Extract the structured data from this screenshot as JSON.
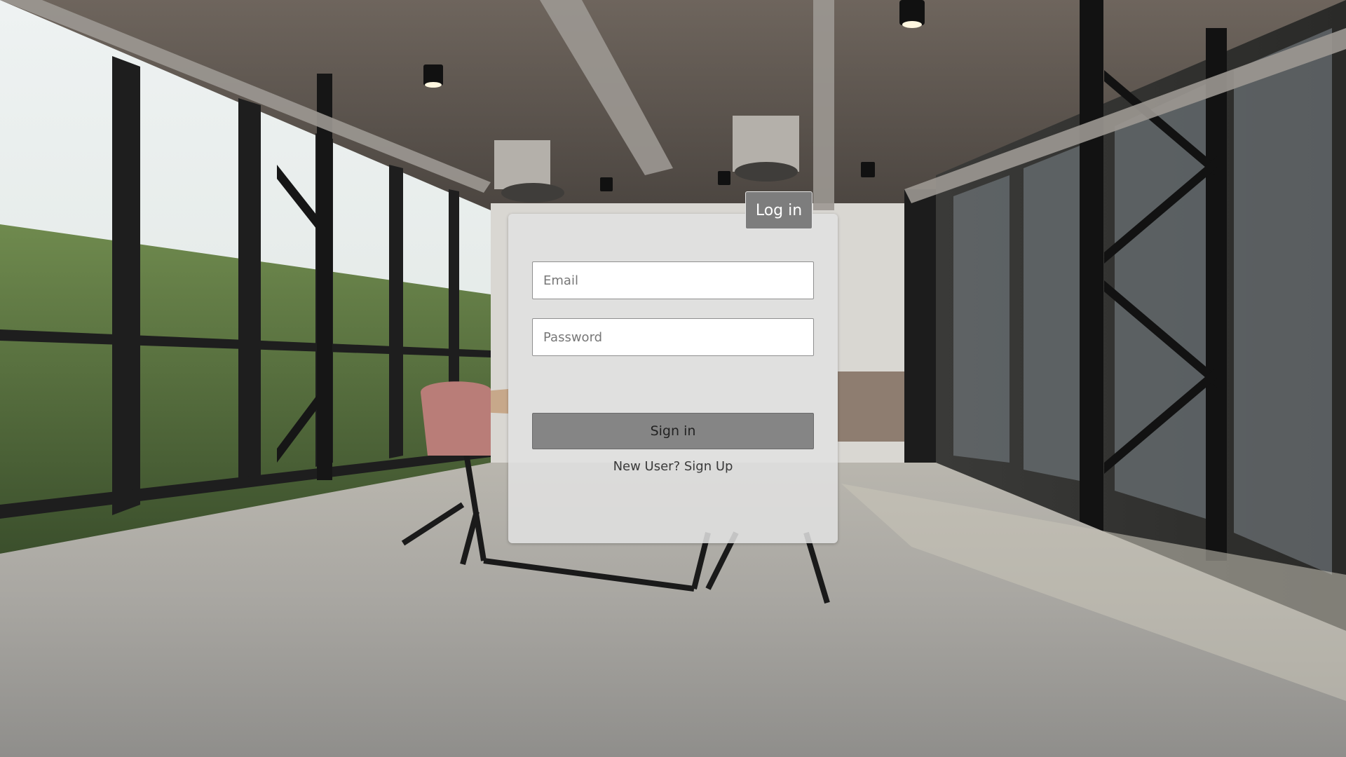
{
  "login_tab": {
    "label": "Log in"
  },
  "form": {
    "email_placeholder": "Email",
    "password_placeholder": "Password",
    "email_value": "",
    "password_value": "",
    "submit_label": "Sign in",
    "signup_link": "New User? Sign Up"
  },
  "colors": {
    "card_background": "#e1e1e1",
    "tab_background": "#7d7d7d",
    "button_background": "#858585"
  }
}
